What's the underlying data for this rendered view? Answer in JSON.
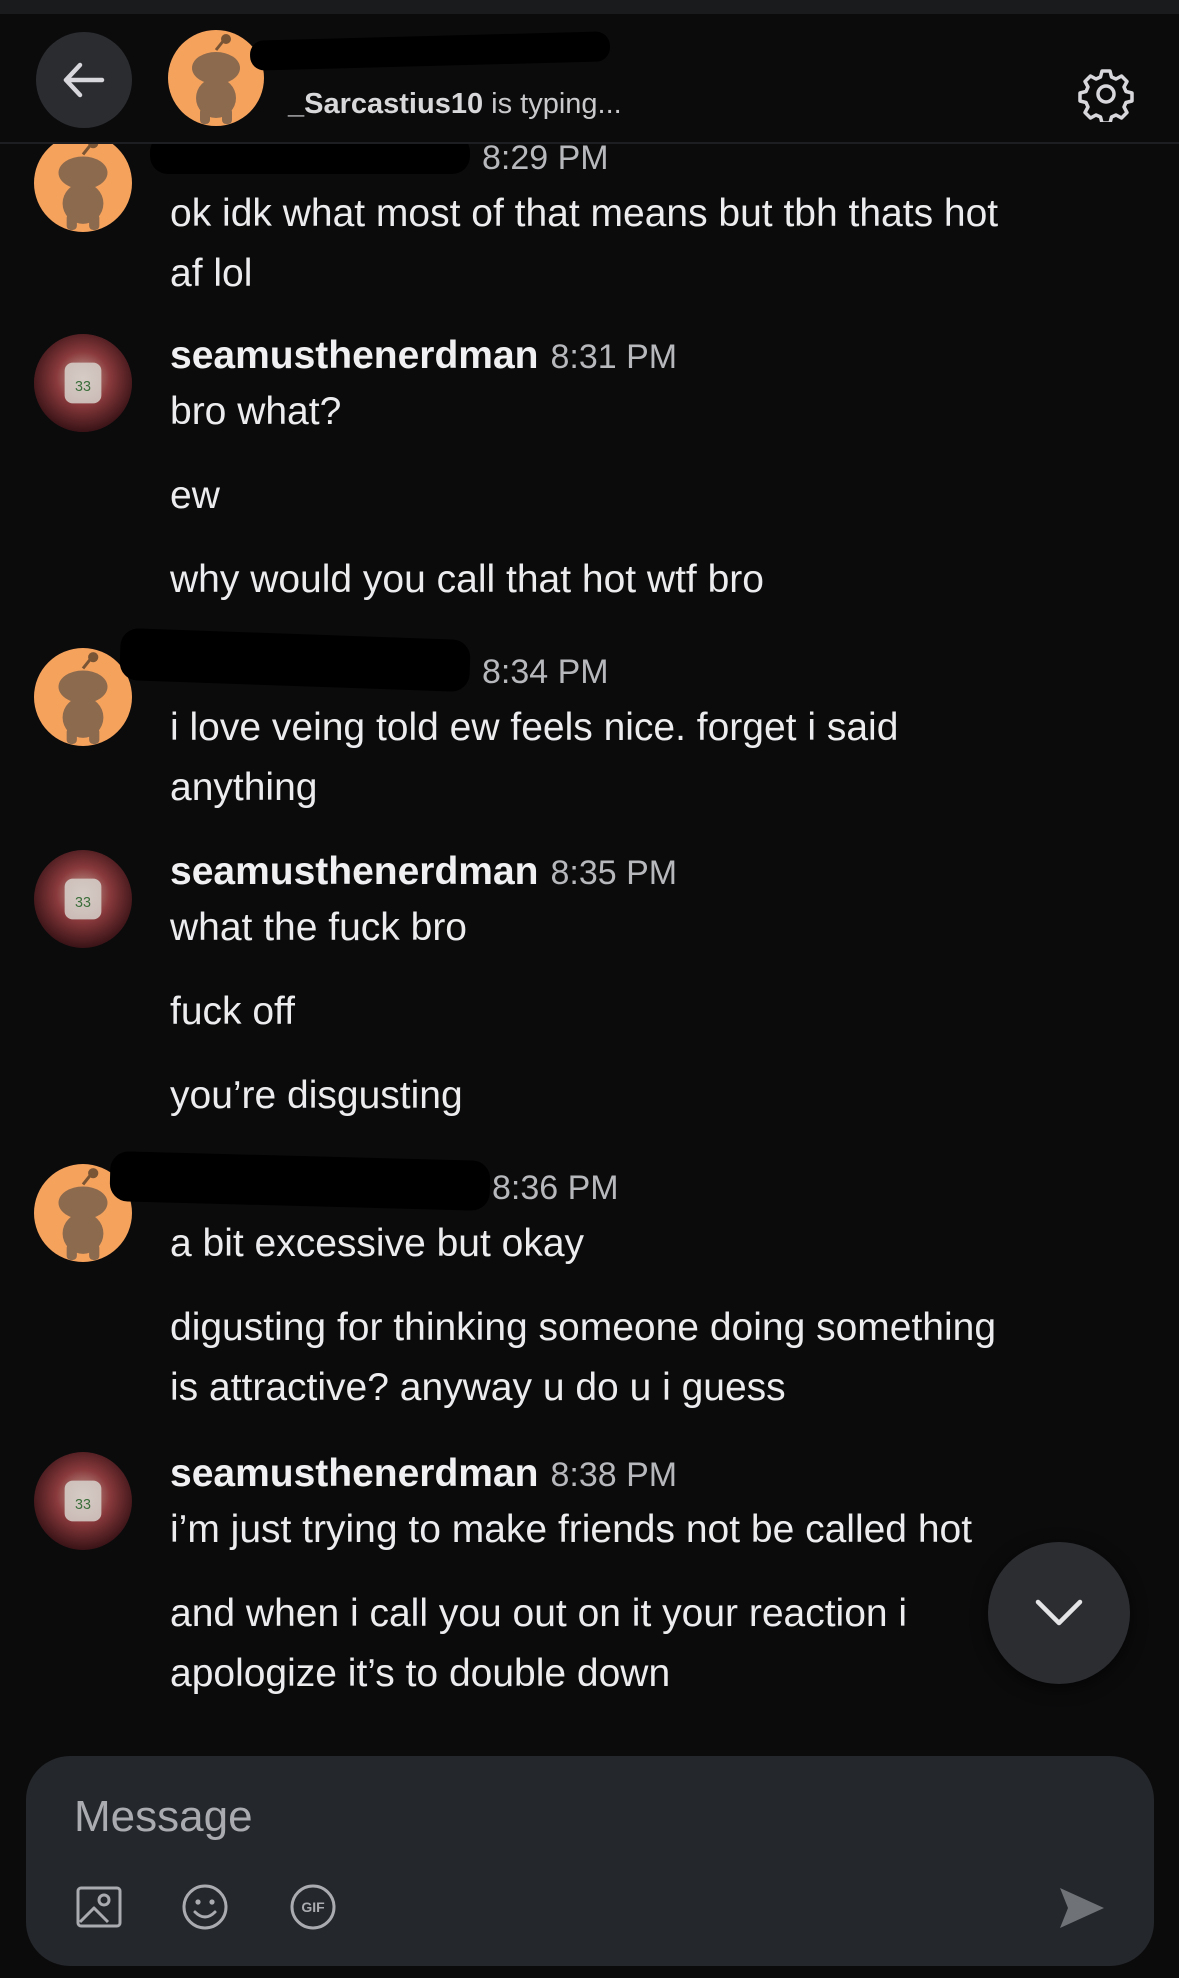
{
  "header": {
    "typing_user": "_Sarcastius10",
    "typing_suffix": "is typing..."
  },
  "messages": [
    {
      "author": "",
      "time": "8:29 PM",
      "lines": [
        "ok idk what most of that means but tbh thats hot",
        "af lol"
      ]
    },
    {
      "author": "seamusthenerdman",
      "time": "8:31 PM",
      "lines": [
        "bro what?",
        "ew",
        "why would you call that hot wtf bro"
      ]
    },
    {
      "author": "",
      "time": "8:34 PM",
      "lines": [
        "i love veing told ew feels nice. forget i said",
        "anything"
      ]
    },
    {
      "author": "seamusthenerdman",
      "time": "8:35 PM",
      "lines": [
        "what the fuck bro",
        "fuck off",
        "you’re disgusting"
      ]
    },
    {
      "author": "",
      "time": "8:36 PM",
      "lines": [
        "a bit excessive but okay",
        "digusting for thinking someone doing something",
        "is attractive? anyway u do u i guess"
      ]
    },
    {
      "author": "seamusthenerdman",
      "time": "8:38 PM",
      "lines": [
        "i’m just trying to make friends not be called hot",
        "and when i call you out on it your reaction i",
        "apologize it’s to double down"
      ]
    }
  ],
  "composer": {
    "placeholder": "Message",
    "gif_label": "GIF"
  },
  "colors": {
    "background": "#0b0b0c",
    "composer": "#24272b",
    "snoo_orange": "#f5a25d"
  },
  "icons": [
    "back-arrow-icon",
    "gear-icon",
    "image-icon",
    "emoji-icon",
    "gif-icon",
    "send-icon",
    "chevron-down-icon"
  ]
}
